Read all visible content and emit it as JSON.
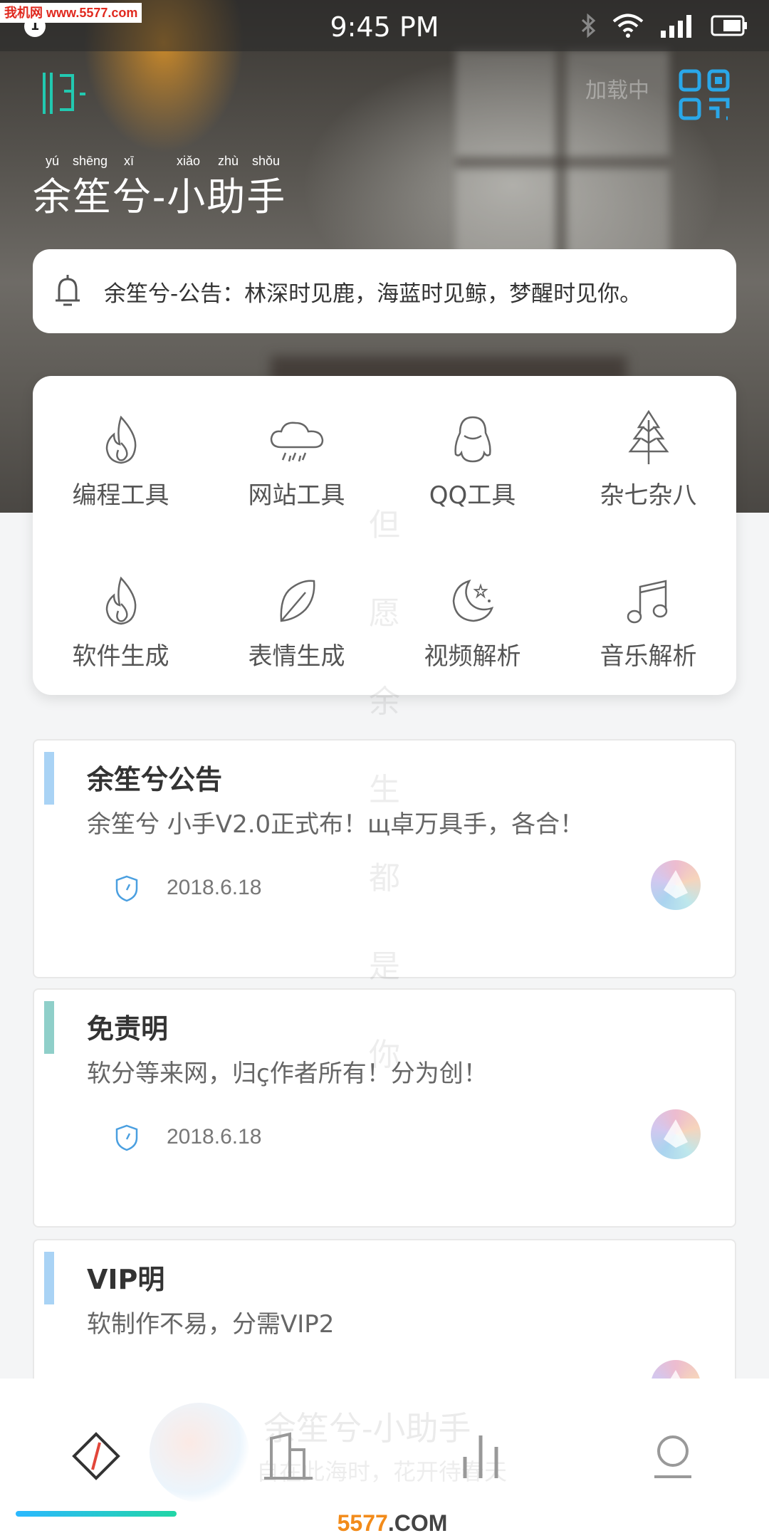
{
  "watermark_top": "我机网 www.5577.com",
  "status_bar": {
    "notification_count": "1",
    "time": "9:45 PM"
  },
  "header": {
    "loading_text": "加载中",
    "app_title": "余笙兮-小助手",
    "pinyin": [
      "yú",
      "shēng",
      "xī",
      "xiǎo",
      "zhù",
      "shǒu"
    ]
  },
  "notice": {
    "text": "余笙兮-公告：林深时见鹿，海蓝时见鲸，梦醒时见你。"
  },
  "tools": [
    {
      "label": "编程工具",
      "icon": "flame-icon"
    },
    {
      "label": "网站工具",
      "icon": "cloud-rain-icon"
    },
    {
      "label": "QQ工具",
      "icon": "penguin-icon"
    },
    {
      "label": "杂七杂八",
      "icon": "tree-icon"
    },
    {
      "label": "软件生成",
      "icon": "flame-icon"
    },
    {
      "label": "表情生成",
      "icon": "leaf-icon"
    },
    {
      "label": "视频解析",
      "icon": "moon-stars-icon"
    },
    {
      "label": "音乐解析",
      "icon": "music-note-icon"
    }
  ],
  "vertical_text": [
    "但",
    "愿",
    "余",
    "生",
    "都",
    "是",
    "你"
  ],
  "posts": [
    {
      "title": "余笙兮公告",
      "body": "余笙兮 小手V2.0正式布！щ卓万具手，各合！",
      "date": "2018.6.18",
      "accent": "#a9d3f5"
    },
    {
      "title": "免责明",
      "body": "软分等来网，归ҫ作者所有！分为创！",
      "date": "2018.6.18",
      "accent": "#8fcfc9"
    },
    {
      "title": "VIP明",
      "body": "软制作不易，分需VIP2",
      "date": "",
      "accent": "#a9d3f5"
    }
  ],
  "bottom_nav": {
    "ghost_title": "余笙兮-小助手",
    "ghost_subtitle": "自在此海时，花开待春天",
    "items": [
      "home",
      "building",
      "stats",
      "profile"
    ]
  },
  "watermark_bottom": {
    "brand": "5577",
    "suffix": ".COM"
  },
  "colors": {
    "accent_teal": "#22c9b0",
    "accent_blue": "#2aa7e8",
    "nav_red": "#e2463a"
  }
}
